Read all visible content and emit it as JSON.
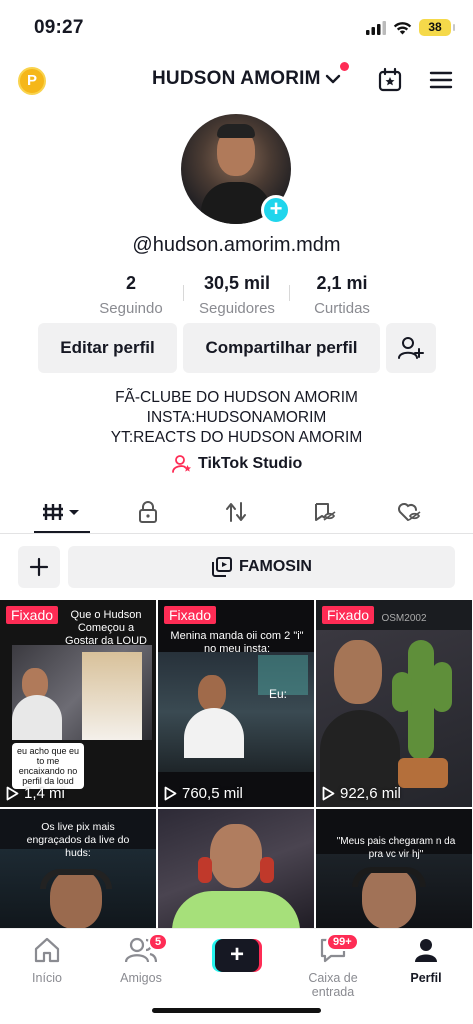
{
  "status_bar": {
    "time": "09:27",
    "battery": "38"
  },
  "header": {
    "coin_label": "P",
    "title": "HUDSON AMORIM"
  },
  "profile": {
    "username": "@hudson.amorim.mdm",
    "stats": [
      {
        "value": "2",
        "label": "Seguindo"
      },
      {
        "value": "30,5 mil",
        "label": "Seguidores"
      },
      {
        "value": "2,1 mi",
        "label": "Curtidas"
      }
    ],
    "buttons": {
      "edit": "Editar perfil",
      "share": "Compartilhar perfil"
    },
    "bio": [
      "FÃ-CLUBE DO HUDSON AMORIM",
      "INSTA:HUDSONAMORIM",
      "YT:REACTS DO HUDSON AMORIM"
    ],
    "studio_label": "TikTok Studio"
  },
  "playlist": {
    "label": "FAMOSIN"
  },
  "videos": [
    {
      "pinned": "Fixado",
      "caption": "Que o Hudson Começou a Gostar da LOUD",
      "views": "1,4 mi",
      "sub_caption": "eu acho que eu to me encaixando no perfil da loud"
    },
    {
      "pinned": "Fixado",
      "caption": "Menina manda oii com 2 \"i\" no meu insta:",
      "views": "760,5 mil",
      "sub_caption": "Eu:"
    },
    {
      "pinned": "Fixado",
      "caption": "OSM2002",
      "views": "922,6 mil"
    },
    {
      "caption": "Os live pix mais engraçados da live do huds:"
    },
    {
      "caption": ""
    },
    {
      "caption": "\"Meus pais chegaram n da pra vc vir hj\""
    }
  ],
  "nav": {
    "items": [
      {
        "label": "Início"
      },
      {
        "label": "Amigos",
        "badge": "5"
      },
      {
        "label": ""
      },
      {
        "label": "Caixa de entrada",
        "badge": "99+"
      },
      {
        "label": "Perfil"
      }
    ]
  },
  "colors": {
    "accent": "#fe2c55",
    "cyan": "#25f4ee",
    "text": "#161823",
    "muted": "#8a8b91"
  }
}
